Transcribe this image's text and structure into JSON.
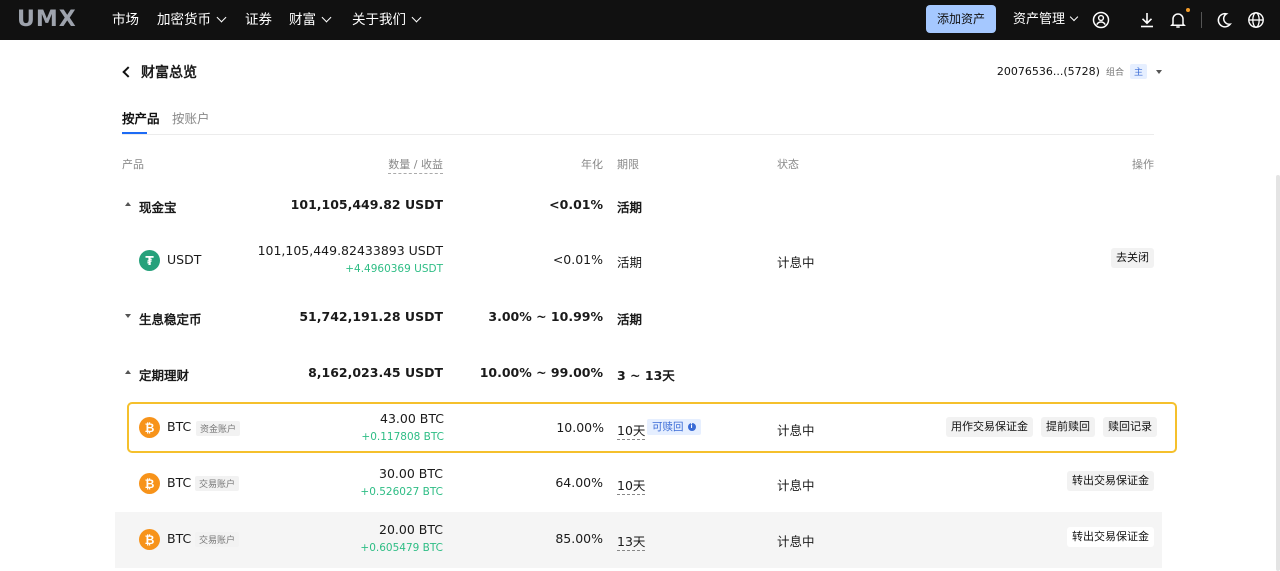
{
  "nav": {
    "logo": "UMX",
    "items": [
      {
        "label": "市场",
        "has_dropdown": false
      },
      {
        "label": "加密货币",
        "has_dropdown": true
      },
      {
        "label": "证券",
        "has_dropdown": false
      },
      {
        "label": "财富",
        "has_dropdown": true
      },
      {
        "label": "关于我们",
        "has_dropdown": true
      }
    ],
    "add_asset": "添加资产",
    "asset_management": "资产管理",
    "icons": [
      "user-icon",
      "download-icon",
      "bell-icon",
      "moon-icon",
      "globe-icon"
    ],
    "colors": {
      "bar": "#111111",
      "accent_button": "#a5c8ff",
      "notification_dot": "#f59d2a"
    }
  },
  "header": {
    "title": "财富总览",
    "account_id": "20076536...(5728)",
    "account_type": "组合",
    "account_main": "主"
  },
  "tabs": [
    {
      "label": "按产品",
      "active": true
    },
    {
      "label": "按账户",
      "active": false
    }
  ],
  "table": {
    "columns": {
      "product": "产品",
      "amount": "数量 / 收益",
      "rate": "年化",
      "term": "期限",
      "status": "状态",
      "actions": "操作"
    },
    "groups": [
      {
        "name": "现金宝",
        "expanded": true,
        "amount": "101,105,449.82 USDT",
        "rate": "<0.01%",
        "term": "活期",
        "items": [
          {
            "coin": "USDT",
            "amount": "101,105,449.82433893 USDT",
            "earnings": "+4.4960369 USDT",
            "rate": "<0.01%",
            "term": "活期",
            "status": "计息中",
            "actions": [
              "去关闭"
            ]
          }
        ]
      },
      {
        "name": "生息稳定币",
        "expanded": false,
        "amount": "51,742,191.28 USDT",
        "rate": "3.00% ~ 10.99%",
        "term": "活期",
        "items": []
      },
      {
        "name": "定期理财",
        "expanded": true,
        "amount": "8,162,023.45 USDT",
        "rate": "10.00% ~ 99.00%",
        "term": "3 ~ 13天",
        "items": [
          {
            "coin": "BTC",
            "account": "资金账户",
            "amount": "43.00 BTC",
            "earnings": "+0.117808 BTC",
            "rate": "10.00%",
            "term": "10天",
            "badge": "可赎回",
            "status": "计息中",
            "actions": [
              "用作交易保证金",
              "提前赎回",
              "赎回记录"
            ],
            "highlighted": true
          },
          {
            "coin": "BTC",
            "account": "交易账户",
            "amount": "30.00 BTC",
            "earnings": "+0.526027 BTC",
            "rate": "64.00%",
            "term": "10天",
            "status": "计息中",
            "actions": [
              "转出交易保证金"
            ]
          },
          {
            "coin": "BTC",
            "account": "交易账户",
            "amount": "20.00 BTC",
            "earnings": "+0.605479 BTC",
            "rate": "85.00%",
            "term": "13天",
            "status": "计息中",
            "actions": [
              "转出交易保证金"
            ]
          }
        ]
      }
    ],
    "colors": {
      "earnings": "#2ebd85",
      "highlight_border": "#f5c02c",
      "usdt": "#26a17b",
      "btc": "#f7931a"
    }
  }
}
